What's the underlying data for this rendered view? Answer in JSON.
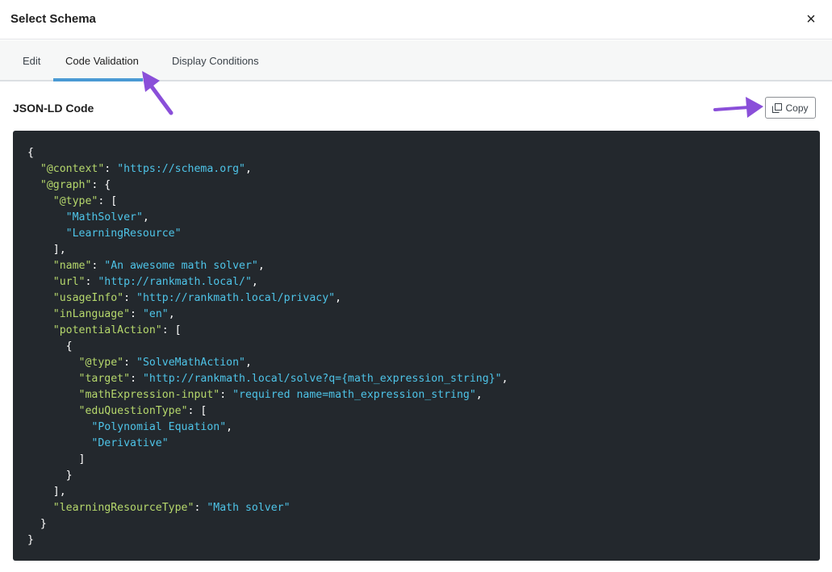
{
  "modal": {
    "title": "Select Schema",
    "close_symbol": "×"
  },
  "tabs": [
    {
      "label": "Edit",
      "active": false
    },
    {
      "label": "Code Validation",
      "active": true
    },
    {
      "label": "Display Conditions",
      "active": false
    }
  ],
  "section": {
    "title": "JSON-LD Code",
    "copy_label": "Copy",
    "copy_icon": "copy-icon"
  },
  "colors": {
    "accent": "#4a9ad4",
    "arrow": "#8a4fd9",
    "code_bg": "#23282d",
    "code_key": "#b6d86c",
    "code_string": "#4ec4e8"
  },
  "code_lines": [
    [
      {
        "t": "p",
        "v": "{"
      }
    ],
    [
      {
        "t": "p",
        "v": "  "
      },
      {
        "t": "k",
        "v": "\"@context\""
      },
      {
        "t": "p",
        "v": ": "
      },
      {
        "t": "s",
        "v": "\"https://schema.org\""
      },
      {
        "t": "p",
        "v": ","
      }
    ],
    [
      {
        "t": "p",
        "v": "  "
      },
      {
        "t": "k",
        "v": "\"@graph\""
      },
      {
        "t": "p",
        "v": ": {"
      }
    ],
    [
      {
        "t": "p",
        "v": "    "
      },
      {
        "t": "k",
        "v": "\"@type\""
      },
      {
        "t": "p",
        "v": ": ["
      }
    ],
    [
      {
        "t": "p",
        "v": "      "
      },
      {
        "t": "s",
        "v": "\"MathSolver\""
      },
      {
        "t": "p",
        "v": ","
      }
    ],
    [
      {
        "t": "p",
        "v": "      "
      },
      {
        "t": "s",
        "v": "\"LearningResource\""
      }
    ],
    [
      {
        "t": "p",
        "v": "    ],"
      }
    ],
    [
      {
        "t": "p",
        "v": "    "
      },
      {
        "t": "k",
        "v": "\"name\""
      },
      {
        "t": "p",
        "v": ": "
      },
      {
        "t": "s",
        "v": "\"An awesome math solver\""
      },
      {
        "t": "p",
        "v": ","
      }
    ],
    [
      {
        "t": "p",
        "v": "    "
      },
      {
        "t": "k",
        "v": "\"url\""
      },
      {
        "t": "p",
        "v": ": "
      },
      {
        "t": "s",
        "v": "\"http://rankmath.local/\""
      },
      {
        "t": "p",
        "v": ","
      }
    ],
    [
      {
        "t": "p",
        "v": "    "
      },
      {
        "t": "k",
        "v": "\"usageInfo\""
      },
      {
        "t": "p",
        "v": ": "
      },
      {
        "t": "s",
        "v": "\"http://rankmath.local/privacy\""
      },
      {
        "t": "p",
        "v": ","
      }
    ],
    [
      {
        "t": "p",
        "v": "    "
      },
      {
        "t": "k",
        "v": "\"inLanguage\""
      },
      {
        "t": "p",
        "v": ": "
      },
      {
        "t": "s",
        "v": "\"en\""
      },
      {
        "t": "p",
        "v": ","
      }
    ],
    [
      {
        "t": "p",
        "v": "    "
      },
      {
        "t": "k",
        "v": "\"potentialAction\""
      },
      {
        "t": "p",
        "v": ": ["
      }
    ],
    [
      {
        "t": "p",
        "v": "      {"
      }
    ],
    [
      {
        "t": "p",
        "v": "        "
      },
      {
        "t": "k",
        "v": "\"@type\""
      },
      {
        "t": "p",
        "v": ": "
      },
      {
        "t": "s",
        "v": "\"SolveMathAction\""
      },
      {
        "t": "p",
        "v": ","
      }
    ],
    [
      {
        "t": "p",
        "v": "        "
      },
      {
        "t": "k",
        "v": "\"target\""
      },
      {
        "t": "p",
        "v": ": "
      },
      {
        "t": "s",
        "v": "\"http://rankmath.local/solve?q={math_expression_string}\""
      },
      {
        "t": "p",
        "v": ","
      }
    ],
    [
      {
        "t": "p",
        "v": "        "
      },
      {
        "t": "k",
        "v": "\"mathExpression-input\""
      },
      {
        "t": "p",
        "v": ": "
      },
      {
        "t": "s",
        "v": "\"required name=math_expression_string\""
      },
      {
        "t": "p",
        "v": ","
      }
    ],
    [
      {
        "t": "p",
        "v": "        "
      },
      {
        "t": "k",
        "v": "\"eduQuestionType\""
      },
      {
        "t": "p",
        "v": ": ["
      }
    ],
    [
      {
        "t": "p",
        "v": "          "
      },
      {
        "t": "s",
        "v": "\"Polynomial Equation\""
      },
      {
        "t": "p",
        "v": ","
      }
    ],
    [
      {
        "t": "p",
        "v": "          "
      },
      {
        "t": "s",
        "v": "\"Derivative\""
      }
    ],
    [
      {
        "t": "p",
        "v": "        ]"
      }
    ],
    [
      {
        "t": "p",
        "v": "      }"
      }
    ],
    [
      {
        "t": "p",
        "v": "    ],"
      }
    ],
    [
      {
        "t": "p",
        "v": "    "
      },
      {
        "t": "k",
        "v": "\"learningResourceType\""
      },
      {
        "t": "p",
        "v": ": "
      },
      {
        "t": "s",
        "v": "\"Math solver\""
      }
    ],
    [
      {
        "t": "p",
        "v": "  }"
      }
    ],
    [
      {
        "t": "p",
        "v": "}"
      }
    ]
  ]
}
